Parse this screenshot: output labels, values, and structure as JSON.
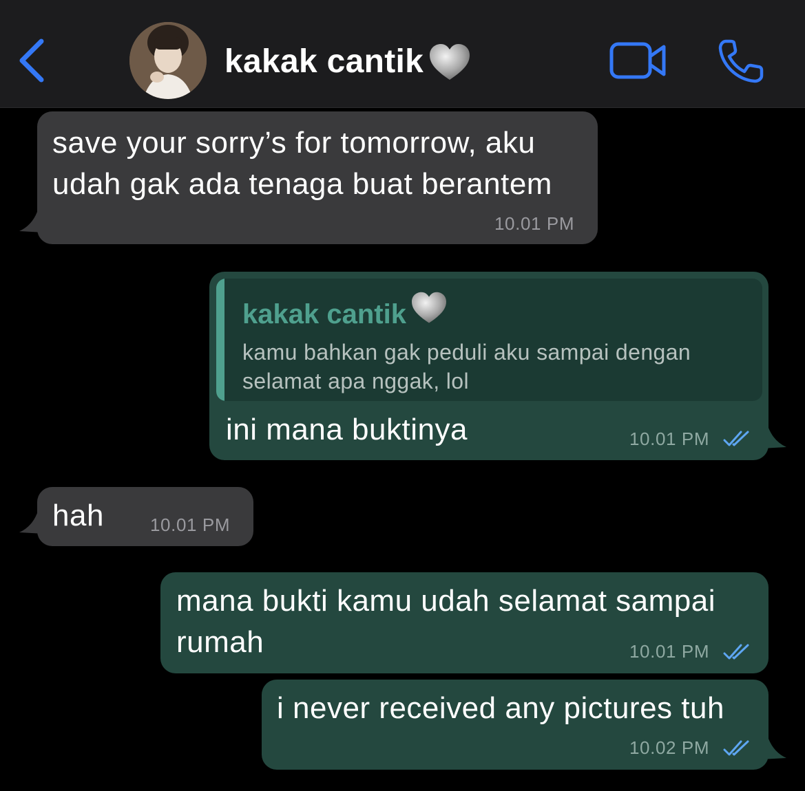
{
  "header": {
    "contact_name": "kakak cantik",
    "contact_emoji": "heart-icon-grey",
    "back_icon": "chevron-left-icon",
    "video_icon": "video-camera-icon",
    "call_icon": "phone-icon"
  },
  "colors": {
    "accent": "#3478f6",
    "incoming_bubble": "#3a3a3c",
    "outgoing_bubble": "#24483f",
    "quote_accent": "#4fa08e",
    "read_ticks": "#5ea6f2"
  },
  "messages": [
    {
      "direction": "incoming",
      "lines": [
        "save your sorry’s for tomorrow, aku",
        "udah gak ada tenaga buat berantem"
      ],
      "time": "10.01 PM"
    },
    {
      "direction": "outgoing",
      "quote": {
        "author": "kakak cantik",
        "lines": [
          "kamu bahkan gak peduli aku sampai dengan",
          "selamat apa nggak, lol"
        ]
      },
      "text": "ini mana buktinya",
      "time": "10.01 PM",
      "status": "read"
    },
    {
      "direction": "incoming",
      "text": "hah",
      "time": "10.01 PM"
    },
    {
      "direction": "outgoing",
      "lines": [
        "mana bukti kamu udah selamat sampai",
        "rumah"
      ],
      "time": "10.01 PM",
      "status": "read"
    },
    {
      "direction": "outgoing",
      "text": "i never received any pictures tuh",
      "time": "10.02 PM",
      "status": "read"
    }
  ]
}
